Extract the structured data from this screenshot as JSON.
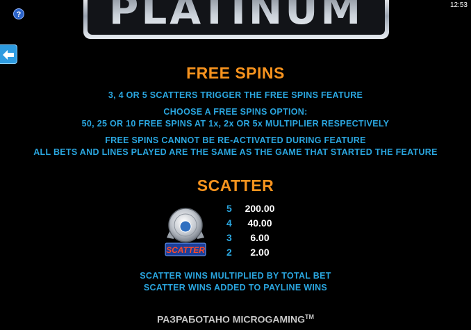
{
  "logo": {
    "text": "PLATINUM"
  },
  "topbar": {
    "help_icon": "question-icon",
    "help_glyph": "?",
    "clock": "12:53"
  },
  "nav": {
    "back_icon": "arrow-left-icon"
  },
  "free_spins": {
    "title": "FREE SPINS",
    "lines": [
      "3, 4 OR 5 SCATTERS TRIGGER THE FREE SPINS FEATURE",
      "CHOOSE A FREE SPINS OPTION:",
      "50, 25 OR 10 FREE SPINS AT 1x, 2x OR 5x MULTIPLIER RESPECTIVELY",
      "FREE SPINS CANNOT BE RE-ACTIVATED DURING FEATURE",
      "ALL BETS AND LINES PLAYED ARE THE SAME AS THE GAME THAT STARTED THE FEATURE"
    ]
  },
  "scatter": {
    "title": "SCATTER",
    "symbol_label": "SCATTER",
    "pays": [
      {
        "count": "5",
        "value": "200.00"
      },
      {
        "count": "4",
        "value": "40.00"
      },
      {
        "count": "3",
        "value": "6.00"
      },
      {
        "count": "2",
        "value": "2.00"
      }
    ],
    "notes": [
      "SCATTER WINS MULTIPLIED BY TOTAL BET",
      "SCATTER WINS ADDED TO PAYLINE WINS"
    ]
  },
  "footer": {
    "text": "РАЗРАБОТАНО MICROGAMING",
    "tm": "TM"
  },
  "colors": {
    "heading": "#f7931e",
    "body_text": "#2aa6df",
    "background": "#000000"
  }
}
